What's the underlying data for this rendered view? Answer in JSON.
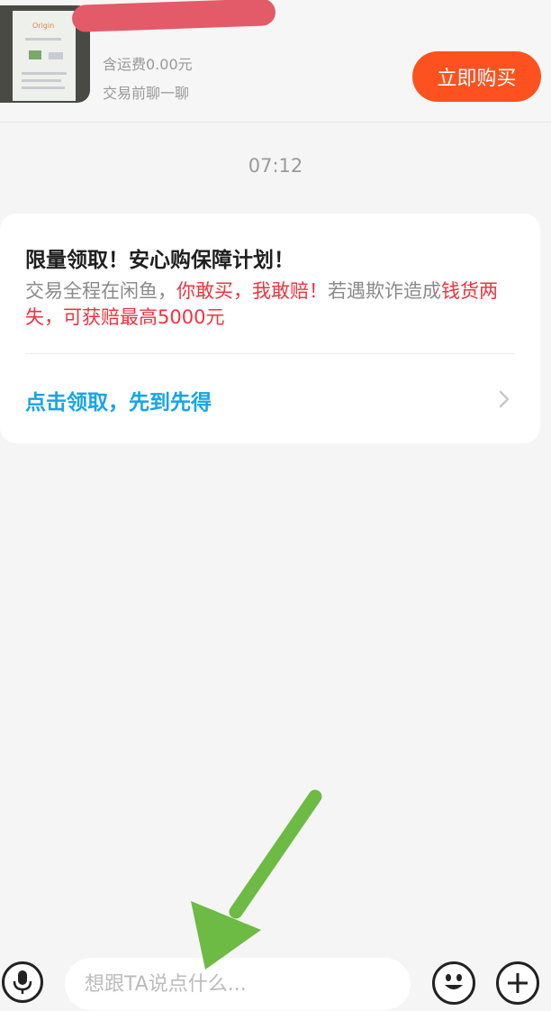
{
  "header": {
    "shipping": "含运费0.00元",
    "chat_hint": "交易前聊一聊",
    "buy_label": "立即购买",
    "buy_color": "#fd5220",
    "thumb_logo": "Origin"
  },
  "chat": {
    "timestamp": "07:12"
  },
  "card": {
    "title": "限量领取！安心购保障计划！",
    "body_part1": "交易全程在闲鱼，",
    "body_red1": "你敢买，我敢赔！",
    "body_part2": "若遇欺诈造成",
    "body_red2": "钱货两失，可获赔最高5000元",
    "link": "点击领取，先到先得",
    "link_color": "#14a5e8",
    "highlight_color": "#ef3340"
  },
  "input_bar": {
    "placeholder": "想跟TA说点什么...",
    "icons": [
      "microphone-icon",
      "emoji-icon",
      "plus-icon"
    ]
  },
  "annotation": {
    "arrow_color": "#6dbb45"
  }
}
